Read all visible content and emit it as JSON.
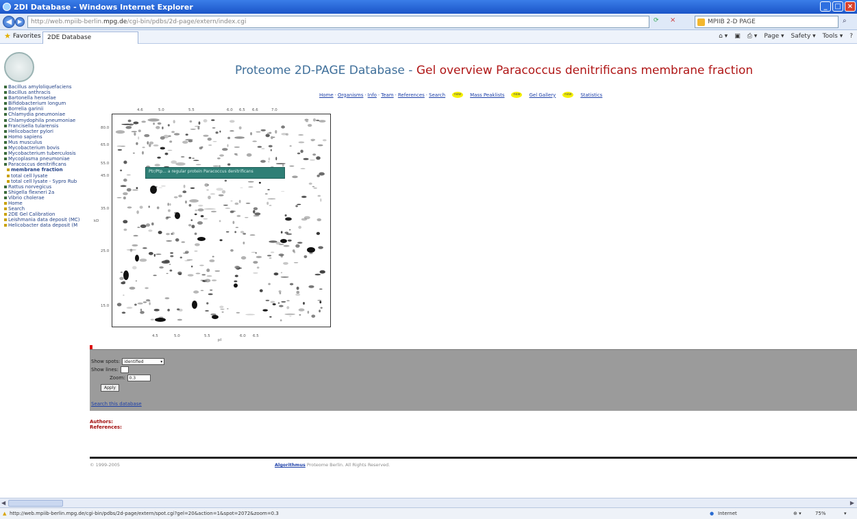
{
  "browser": {
    "window_title": "2DI Database - Windows Internet Explorer",
    "address_host": "mpg.de",
    "search_provider": "MPIIB 2-D PAGE",
    "favorites_label": "Favorites",
    "tab_label": "2DE Database",
    "commands": [
      "Page ▾",
      "Safety ▾",
      "Tools ▾"
    ],
    "status_url": "http://web.mpiib-berlin.mpg.de/cgi-bin/pdbs/2d-page/extern/spot.cgi?gel=20&action=1&spot=2072&zoom=0.3",
    "status_zone": "Internet",
    "zoom_level": "75%"
  },
  "page": {
    "heading_main": "Proteome 2D-PAGE Database - ",
    "heading_red": "Gel overview Paracoccus denitrificans membrane fraction",
    "nav": [
      {
        "label": "Home",
        "sep": " · "
      },
      {
        "label": "Organisms",
        "sep": " · "
      },
      {
        "label": "Info",
        "sep": " · "
      },
      {
        "label": "Team",
        "sep": " · "
      },
      {
        "label": "References",
        "sep": " · "
      },
      {
        "label": "Search",
        "sep": "",
        "badge": "new"
      },
      {
        "label": "Mass Peaklists",
        "sep": "",
        "badge": "new"
      },
      {
        "label": "Gel Gallery",
        "sep": "",
        "badge": "new"
      },
      {
        "label": "Statistics",
        "sep": ""
      }
    ],
    "new_badge": "new",
    "sidebar": [
      {
        "label": "Bacillus amyloliquefaciens",
        "type": "top"
      },
      {
        "label": "Bacillus anthracis",
        "type": "top"
      },
      {
        "label": "Bartonella henselae",
        "type": "top"
      },
      {
        "label": "Bifidobacterium longum",
        "type": "top"
      },
      {
        "label": "Borrelia garinii",
        "type": "top"
      },
      {
        "label": "Chlamydia pneumoniae",
        "type": "top"
      },
      {
        "label": "Chlamydophila pneumoniae",
        "type": "top"
      },
      {
        "label": "Francisella tularensis",
        "type": "top"
      },
      {
        "label": "Helicobacter pylori",
        "type": "top"
      },
      {
        "label": "Homo sapiens",
        "type": "top"
      },
      {
        "label": "Mus musculus",
        "type": "top"
      },
      {
        "label": "Mycobacterium bovis",
        "type": "top"
      },
      {
        "label": "Mycobacterium tuberculosis",
        "type": "top"
      },
      {
        "label": "Mycoplasma pneumoniae",
        "type": "top"
      },
      {
        "label": "Paracoccus denitrificans",
        "type": "top"
      },
      {
        "label": "membrane fraction",
        "type": "sub-bold"
      },
      {
        "label": "total cell lysate",
        "type": "sub"
      },
      {
        "label": "total cell lysate - Sypro Rub",
        "type": "sub"
      },
      {
        "label": "Rattus norvegicus",
        "type": "top"
      },
      {
        "label": "Shigella flexneri 2a",
        "type": "top"
      },
      {
        "label": "Vibrio cholerae",
        "type": "top"
      },
      {
        "label": "Home",
        "type": "yellow"
      },
      {
        "label": "Search",
        "type": "yellow"
      },
      {
        "label": "2DE Gel Calibration",
        "type": "yellow"
      },
      {
        "label": "Leishmania data deposit (MC)",
        "type": "yellow"
      },
      {
        "label": "Helicobacter data deposit (M",
        "type": "yellow"
      }
    ],
    "gel": {
      "overlay_text": "Ptr/Ptp...   a regular  protein  Paracoccus denitrificans",
      "top_ticks": [
        "4.6",
        "5.0",
        "5.5",
        "6.0",
        "6.5",
        "6.6",
        "7.0"
      ],
      "left_ticks": [
        "80.0",
        "65.0",
        "55.0",
        "45.0",
        "35.0",
        "25.0",
        "15.0"
      ],
      "bottom_ticks": [
        "4.5",
        "5.0",
        "5.5",
        "6.0",
        "6.5"
      ],
      "bottom_axis_label": "pI",
      "left_axis_label": "kD"
    },
    "controls": {
      "show_spots_label": "Show spots:",
      "show_spots_value": "identified",
      "show_lines_label": "Show lines:",
      "zoom_label": "Zoom:",
      "zoom_value": "0.3",
      "apply_label": "Apply"
    },
    "search_db_link": "Search this database",
    "authors_label": "Authors:",
    "references_label": "References:",
    "footer_left": "© 1999-2005",
    "footer_link": "Algorithmus",
    "footer_rest": "Proteome Berlin. All Rights Reserved."
  }
}
